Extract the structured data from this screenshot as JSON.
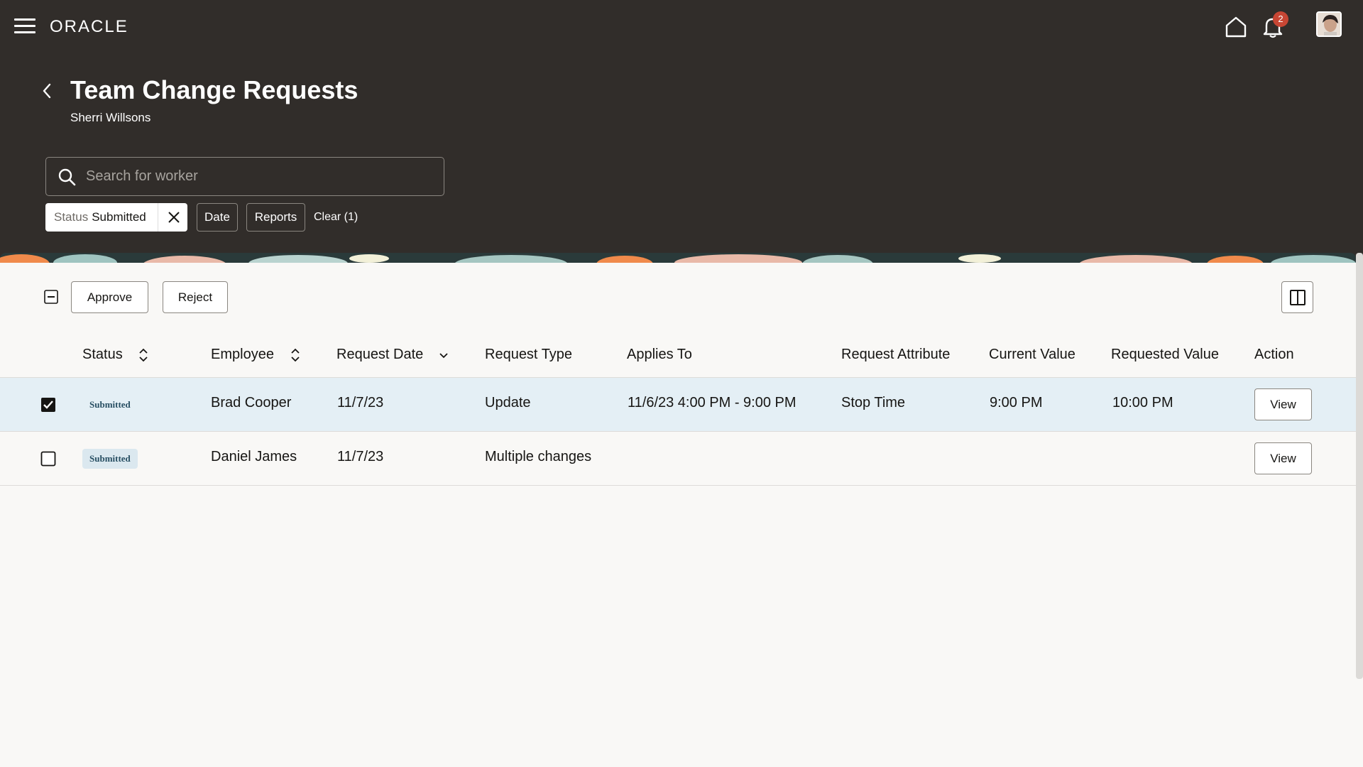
{
  "header": {
    "brand": "ORACLE",
    "notifications_count": "2",
    "title": "Team Change Requests",
    "subtitle": "Sherri Willsons"
  },
  "search": {
    "placeholder": "Search for worker",
    "value": ""
  },
  "filters": {
    "status_label": "Status",
    "status_value": "Submitted",
    "date_label": "Date",
    "reports_label": "Reports",
    "clear_label": "Clear (1)"
  },
  "toolbar": {
    "approve_label": "Approve",
    "reject_label": "Reject"
  },
  "table": {
    "columns": {
      "status": "Status",
      "employee": "Employee",
      "request_date": "Request Date",
      "request_type": "Request Type",
      "applies_to": "Applies To",
      "request_attribute": "Request Attribute",
      "current_value": "Current Value",
      "requested_value": "Requested Value",
      "action": "Action"
    },
    "rows": [
      {
        "selected": true,
        "status": "Submitted",
        "employee": "Brad Cooper",
        "request_date": "11/7/23",
        "request_type": "Update",
        "applies_to": "11/6/23 4:00 PM - 9:00 PM",
        "request_attribute": "Stop Time",
        "current_value": "9:00 PM",
        "requested_value": "10:00 PM",
        "action": "View"
      },
      {
        "selected": false,
        "status": "Submitted",
        "employee": "Daniel James",
        "request_date": "11/7/23",
        "request_type": "Multiple changes",
        "applies_to": "",
        "request_attribute": "",
        "current_value": "",
        "requested_value": "",
        "action": "View"
      }
    ]
  },
  "colors": {
    "header_bg": "#312d2a",
    "page_bg": "#f9f8f6",
    "selected_row": "#e4eff5",
    "badge_bg": "#dbe8ef",
    "notification": "#c74634"
  }
}
